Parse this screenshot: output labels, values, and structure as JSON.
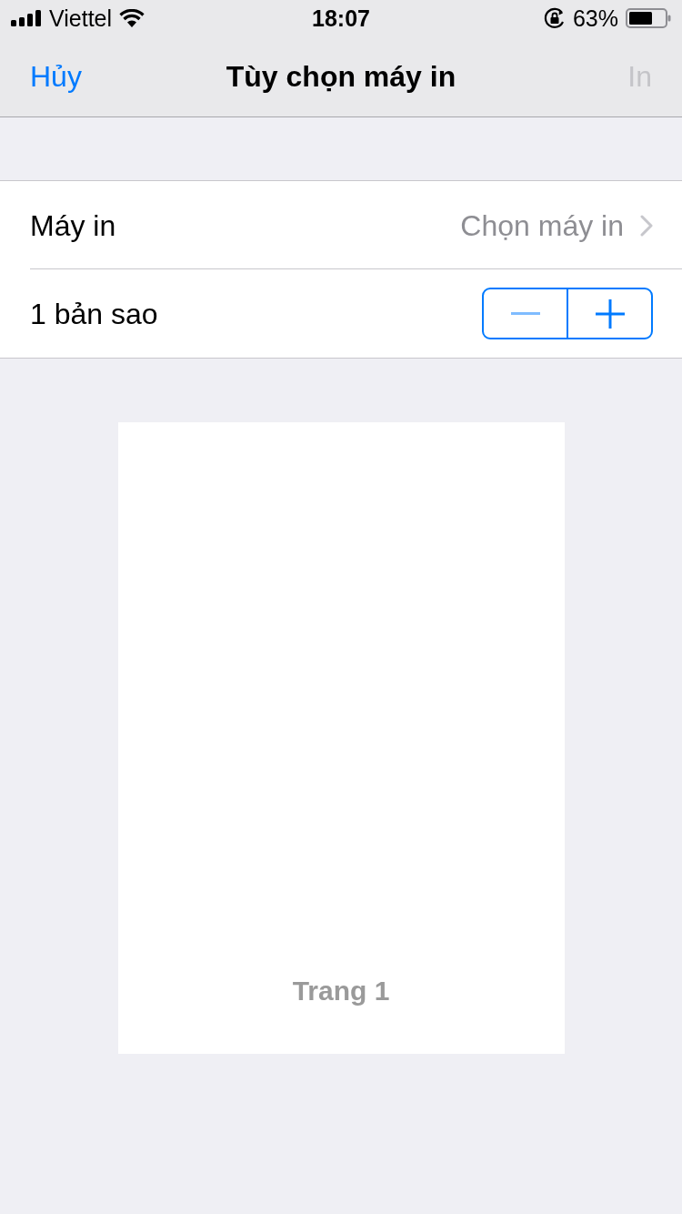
{
  "status_bar": {
    "carrier": "Viettel",
    "time": "18:07",
    "battery": "63%"
  },
  "nav_bar": {
    "cancel": {
      "label": "Hủy",
      "disabled": false
    },
    "title": "Tùy chọn máy in",
    "print": {
      "label": "In",
      "disabled": true
    }
  },
  "options": [
    {
      "kind": "link",
      "label": "Máy in",
      "value": "Chọn máy in"
    },
    {
      "kind": "stepper",
      "label": "1 bản sao",
      "decrement_disabled": true,
      "increment_disabled": false
    }
  ],
  "preview": {
    "page_label": "Trang 1"
  }
}
